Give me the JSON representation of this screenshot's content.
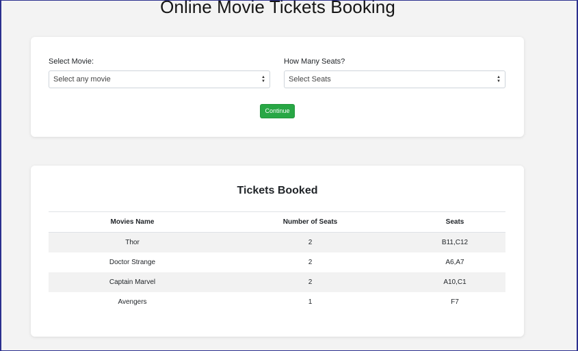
{
  "header": {
    "title": "Online Movie Tickets Booking"
  },
  "form": {
    "movie_label": "Select Movie:",
    "movie_selected": "Select any movie",
    "seats_label": "How Many Seats?",
    "seats_selected": "Select Seats",
    "continue_label": "Continue",
    "button_color": "#28a745"
  },
  "booked": {
    "title": "Tickets Booked",
    "columns": [
      "Movies Name",
      "Number of Seats",
      "Seats"
    ],
    "rows": [
      {
        "movie": "Thor",
        "count": "2",
        "seats": "B11,C12"
      },
      {
        "movie": "Doctor Strange",
        "count": "2",
        "seats": "A6,A7"
      },
      {
        "movie": "Captain Marvel",
        "count": "2",
        "seats": "A10,C1"
      },
      {
        "movie": "Avengers",
        "count": "1",
        "seats": "F7"
      }
    ]
  }
}
